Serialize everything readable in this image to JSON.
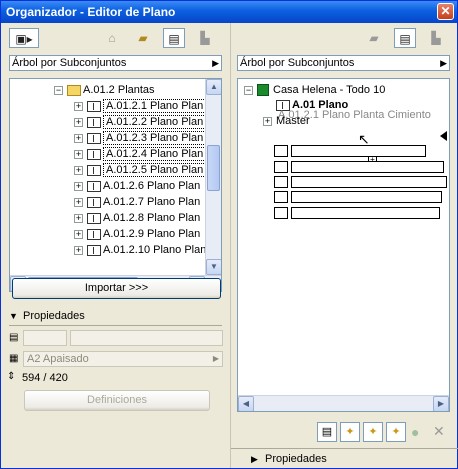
{
  "window": {
    "title": "Organizador - Editor de Plano",
    "close_label": "✕"
  },
  "left": {
    "toolbar": {
      "view_menu_icon": "view-menu-icon",
      "house_icon": "house-icon",
      "folder_icon": "folder-icon",
      "layout_icon": "layout-icon",
      "publish_icon": "publish-icon"
    },
    "dropdown_label": "Árbol por Subconjuntos",
    "tree": {
      "parent_label": "A.01.2 Plantas",
      "items": [
        {
          "label": "A.01.2.1 Plano Plan"
        },
        {
          "label": "A.01.2.2 Plano Plan"
        },
        {
          "label": "A.01.2.3 Plano Plan"
        },
        {
          "label": "A.01.2.4 Plano Plan"
        },
        {
          "label": "A.01.2.5 Plano Plan"
        },
        {
          "label": "A.01.2.6 Plano Plan"
        },
        {
          "label": "A.01.2.7 Plano Plan"
        },
        {
          "label": "A.01.2.8 Plano Plan"
        },
        {
          "label": "A.01.2.9 Plano Plan"
        },
        {
          "label": "A.01.2.10 Plano Plan"
        }
      ]
    },
    "import_button": "Importar >>>",
    "properties": {
      "header": "Propiedades",
      "paper_size": "A2 Apaisado",
      "dimensions": "594 / 420",
      "definitions_button": "Definiciones"
    }
  },
  "right": {
    "dropdown_label": "Árbol por Subconjuntos",
    "tree": {
      "root_label": "Casa Helena - Todo 10",
      "plan_label": "A.01 Plano",
      "ghost_label": "A.01.2.1 Plano Planta Cimiento",
      "master_label": "Master"
    },
    "properties_header": "Propiedades"
  },
  "colors": {
    "title_bar": "#0a5fe0",
    "window_bg": "#ece9d8",
    "border": "#7f9db9"
  }
}
